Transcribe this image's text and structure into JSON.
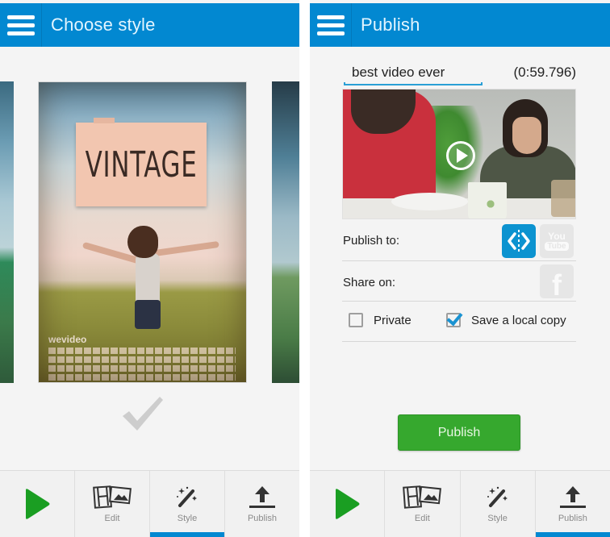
{
  "left_screen": {
    "appbar": {
      "menu_icon": "hamburger-menu-icon",
      "title": "Choose style"
    },
    "carousel": {
      "selected_style": {
        "title": "VINTAGE",
        "brand": "wevideo"
      },
      "selected_indicator_icon": "checkmark-icon"
    },
    "toolbar": {
      "items": [
        {
          "icon": "play-icon",
          "label": ""
        },
        {
          "icon": "film-photo-icon",
          "label": "Edit"
        },
        {
          "icon": "magic-wand-icon",
          "label": "Style"
        },
        {
          "icon": "upload-icon",
          "label": "Publish"
        }
      ],
      "active": "Style"
    }
  },
  "right_screen": {
    "appbar": {
      "menu_icon": "hamburger-menu-icon",
      "title": "Publish"
    },
    "video_title": {
      "value": "best video ever",
      "placeholder": ""
    },
    "duration": "(0:59.796)",
    "video_thumbnail": {
      "play_icon": "play-circle-icon"
    },
    "publish_to": {
      "label": "Publish to:",
      "services": [
        {
          "name": "WeVideo",
          "icon": "wevideo-icon",
          "selected": true,
          "color": "#0c93d0"
        },
        {
          "name": "YouTube",
          "icon": "youtube-icon",
          "selected": false,
          "text_top": "You",
          "text_bottom": "Tube"
        }
      ]
    },
    "share_on": {
      "label": "Share on:",
      "services": [
        {
          "name": "Facebook",
          "icon": "facebook-icon",
          "selected": false,
          "glyph": "f"
        }
      ]
    },
    "options": {
      "private": {
        "label": "Private",
        "checked": false
      },
      "save_local_copy": {
        "label": "Save a local copy",
        "checked": true
      }
    },
    "publish_button": "Publish",
    "toolbar": {
      "items": [
        {
          "icon": "play-icon",
          "label": ""
        },
        {
          "icon": "film-photo-icon",
          "label": "Edit"
        },
        {
          "icon": "magic-wand-icon",
          "label": "Style"
        },
        {
          "icon": "upload-icon",
          "label": "Publish"
        }
      ],
      "active": "Publish"
    }
  },
  "colors": {
    "appbar": "#0288d1",
    "accent": "#0288d1",
    "publish_button": "#36a82e",
    "play_icon": "#1a9e22",
    "checkbox_check": "#1a93d2"
  }
}
